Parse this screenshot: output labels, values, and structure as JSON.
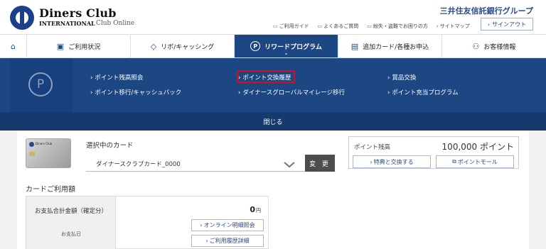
{
  "header": {
    "brand_name": "Diners Club",
    "brand_sub": "INTERNATIONAL",
    "brand_service": "Club Online",
    "group_name": "三井住友信託銀行グループ",
    "utility_links": [
      {
        "icon": "document-icon",
        "label": "ご利用ガイド"
      },
      {
        "icon": "question-icon",
        "label": "よくあるご質問"
      },
      {
        "icon": "warning-icon",
        "label": "紛失・盗難でお困りの方"
      },
      {
        "icon": "chevron-right-icon",
        "label": "サイトマップ"
      }
    ],
    "signout_label": "サインアウト"
  },
  "nav": {
    "items": [
      {
        "key": "home",
        "label": "",
        "icon": "home-icon"
      },
      {
        "key": "usage",
        "label": "ご利用状況",
        "icon": "clipboard-icon"
      },
      {
        "key": "revolving",
        "label": "リボ/キャッシング",
        "icon": "diamond-icon"
      },
      {
        "key": "rewards",
        "label": "リワードプログラム",
        "icon": "p-circle-icon",
        "active": true
      },
      {
        "key": "add_card",
        "label": "追加カード/各種お申込",
        "icon": "form-icon"
      },
      {
        "key": "customer",
        "label": "お客様情報",
        "icon": "user-icon"
      }
    ]
  },
  "mega_menu": {
    "links": [
      {
        "label": "ポイント残高照会"
      },
      {
        "label": "ポイント移行/キャッシュバック"
      },
      {
        "label": "ポイント交換履歴",
        "highlighted": true
      },
      {
        "label": "ダイナースグローバルマイレージ移行"
      },
      {
        "label": "賞品交換"
      },
      {
        "label": "ポイント充当プログラム"
      }
    ],
    "close_label": "閉じる"
  },
  "card_selector": {
    "label": "選択中のカード",
    "selected_card": "ダイナースクラブカード_0000",
    "change_label": "変 更",
    "card_logo_text": "Diners Club"
  },
  "points": {
    "label": "ポイント残高",
    "value": "100,000 ポイント",
    "exchange_label": "特典と交換する",
    "mall_label": "ポイントモール"
  },
  "usage": {
    "title": "カードご利用額",
    "row_label": "お支払合計金額（確定分）",
    "row_sub": "お支払日",
    "amount": "0",
    "amount_unit": "円",
    "online_label": "オンライン明細照会",
    "history_label": "ご利用履歴詳細"
  },
  "colors": {
    "primary": "#1d4783",
    "highlight": "#d0101b",
    "dark_button": "#4d4d4d"
  }
}
